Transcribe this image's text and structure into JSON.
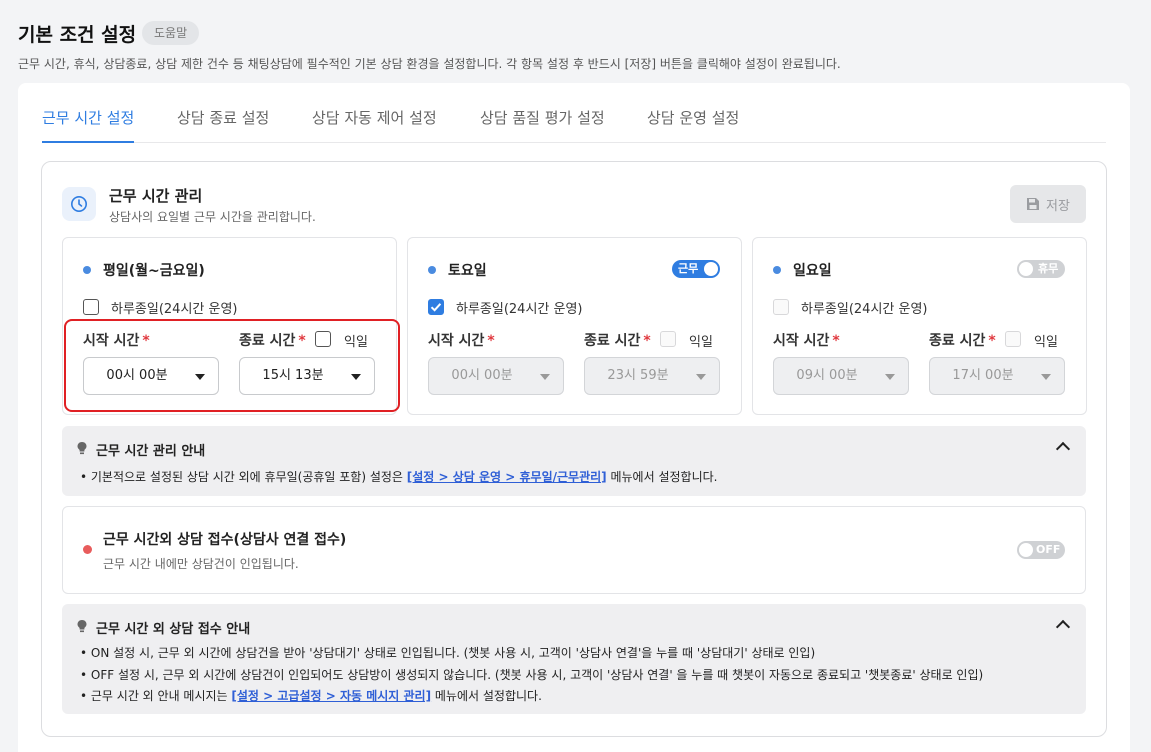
{
  "header": {
    "title": "기본 조건 설정",
    "help_label": "도움말",
    "description": "근무 시간, 휴식, 상담종료, 상담 제한 건수 등 채팅상담에 필수적인 기본 상담 환경을 설정합니다. 각 항목 설정 후 반드시 [저장] 버튼을 클릭해야 설정이 완료됩니다."
  },
  "tabs": [
    {
      "label": "근무 시간 설정",
      "active": true
    },
    {
      "label": "상담 종료 설정",
      "active": false
    },
    {
      "label": "상담 자동 제어 설정",
      "active": false
    },
    {
      "label": "상담 품질 평가 설정",
      "active": false
    },
    {
      "label": "상담 운영 설정",
      "active": false
    }
  ],
  "section": {
    "title": "근무 시간 관리",
    "description": "상담사의 요일별 근무 시간을 관리합니다.",
    "save_label": "저장",
    "icon": "clock-icon"
  },
  "days": [
    {
      "name": "평일(월~금요일)",
      "all_day_label": "하루종일(24시간 운영)",
      "all_day_checked": false,
      "start_label": "시작 시간",
      "end_label": "종료 시간",
      "next_day_label": "익일",
      "start_time": "00시 00분",
      "end_time": "15시 13분",
      "toggle": null,
      "disabled": false
    },
    {
      "name": "토요일",
      "all_day_label": "하루종일(24시간 운영)",
      "all_day_checked": true,
      "start_label": "시작 시간",
      "end_label": "종료 시간",
      "next_day_label": "익일",
      "start_time": "00시 00분",
      "end_time": "23시 59분",
      "toggle": "근무",
      "disabled": true
    },
    {
      "name": "일요일",
      "all_day_label": "하루종일(24시간 운영)",
      "all_day_checked": false,
      "start_label": "시작 시간",
      "end_label": "종료 시간",
      "next_day_label": "익일",
      "start_time": "09시 00분",
      "end_time": "17시 00분",
      "toggle": "휴무",
      "disabled": true
    }
  ],
  "required_mark": "*",
  "info1": {
    "title": "근무 시간 관리 안내",
    "bullet_prefix": "• 기본적으로 설정된 상담 시간 외에 휴무일(공휴일 포함) 설정은 ",
    "link": "[설정 > 상담 운영 > 휴무일/근무관리]",
    "bullet_suffix": " 메뉴에서 설정합니다."
  },
  "after_hours": {
    "title": "근무 시간외 상담 접수(상담사 연결 접수)",
    "description": "근무 시간 내에만 상담건이 인입됩니다.",
    "toggle": "OFF",
    "status_color": "#e85c5c"
  },
  "info2": {
    "title": "근무 시간 외 상담 접수 안내",
    "bullet1": "• ON 설정 시, 근무 외 시간에 상담건을 받아 '상담대기' 상태로 인입됩니다. (챗봇 사용 시, 고객이 '상담사 연결'을 누를 때 '상담대기' 상태로 인입)",
    "bullet2": "• OFF 설정 시, 근무 외 시간에 상담건이 인입되어도 상담방이 생성되지 않습니다. (챗봇 사용 시, 고객이 '상담사 연결' 을 누를 때 챗봇이 자동으로 종료되고 '챗봇종료' 상태로 인입)",
    "bullet3_prefix": "• 근무 시간 외 안내 메시지는 ",
    "bullet3_link": "[설정 > 고급설정 > 자동 메시지 관리]",
    "bullet3_suffix": " 메뉴에서 설정합니다."
  },
  "colors": {
    "accent": "#2f7de1",
    "highlight": "#e02024",
    "alert_dot": "#e85c5c"
  }
}
